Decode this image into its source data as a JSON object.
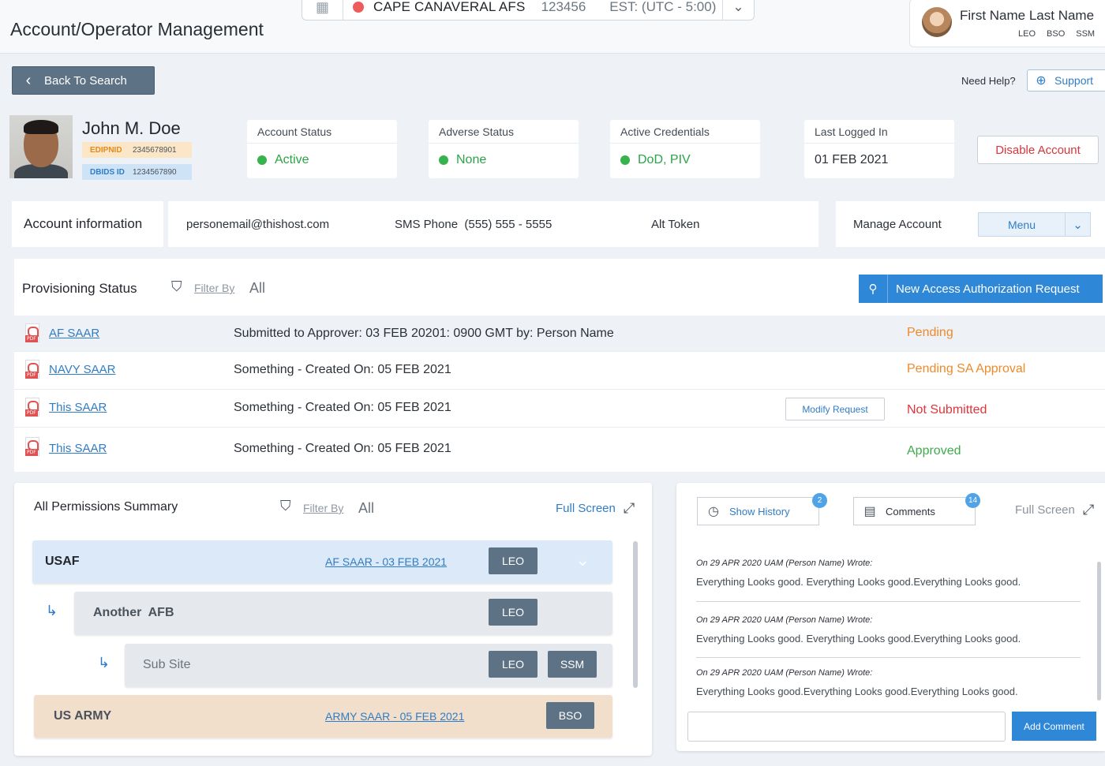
{
  "header": {
    "app_title": "Account/Operator Management",
    "site": {
      "name": "CAPE CANAVERAL AFS",
      "code": "123456",
      "timezone": "EST: (UTC - 5:00)",
      "status_color": "#ef5a5a"
    },
    "user": {
      "name": "First Name Last Name",
      "roles": [
        "LEO",
        "BSO",
        "SSM"
      ]
    }
  },
  "nav": {
    "back_label": "Back To Search",
    "need_help": "Need Help?",
    "support_label": "Support"
  },
  "profile": {
    "name": "John M. Doe",
    "edipnid_label": "EDIPNID",
    "edipnid_value": "2345678901",
    "dbids_label": "DBIDS ID",
    "dbids_value": "1234567890"
  },
  "stats": [
    {
      "label": "Account Status",
      "value": "Active"
    },
    {
      "label": "Adverse Status",
      "value": "None"
    },
    {
      "label": "Active Credentials",
      "value": "DoD, PIV"
    },
    {
      "label": "Last Logged In",
      "value": "01 FEB 2021"
    }
  ],
  "disable_label": "Disable Account",
  "account": {
    "label": "Account information",
    "email": "personemail@thishost.com",
    "sms": "SMS Phone  (555) 555 - 5555",
    "alt_token": "Alt Token",
    "manage_label": "Manage Account",
    "menu_label": "Menu"
  },
  "provisioning": {
    "title": "Provisioning Status",
    "filter_by": "Filter By",
    "filter_value": "All",
    "new_request": "New Access Authorization Request",
    "rows": [
      {
        "name": "AF SAAR",
        "desc": "Submitted to Approver: 03 FEB 20201: 0900 GMT by: Person Name",
        "status": "Pending"
      },
      {
        "name": "NAVY SAAR",
        "desc": "Something - Created On: 05 FEB 2021",
        "status": "Pending SA Approval"
      },
      {
        "name": "This SAAR",
        "desc": "Something - Created On: 05 FEB 2021",
        "status": "Not Submitted",
        "action": "Modify Request"
      },
      {
        "name": "This SAAR",
        "desc": "Something - Created On: 05 FEB 2021",
        "status": "Approved"
      }
    ]
  },
  "permissions": {
    "title": "All Permissions Summary",
    "filter_by": "Filter By",
    "filter_value": "All",
    "full_screen": "Full Screen",
    "rows": [
      {
        "label": "USAF",
        "link": "AF SAAR - 03 FEB 2021",
        "roles": [
          "LEO"
        ]
      },
      {
        "label": "Another  AFB",
        "roles": [
          "LEO"
        ]
      },
      {
        "label": "Sub Site",
        "roles": [
          "LEO",
          "SSM"
        ]
      },
      {
        "label": "US ARMY",
        "link": "ARMY SAAR - 05 FEB 2021",
        "roles": [
          "BSO"
        ]
      }
    ]
  },
  "comments": {
    "history_label": "Show History",
    "history_count": "2",
    "comments_label": "Comments",
    "comments_count": "14",
    "full_screen": "Full Screen",
    "items": [
      {
        "meta": "On 29 APR 2020 UAM (Person Name) Wrote:",
        "body": "Everything Looks good. Everything Looks good.Everything Looks good."
      },
      {
        "meta": "On 29 APR 2020 UAM (Person Name) Wrote:",
        "body": "Everything Looks good. Everything Looks good.Everything Looks good."
      },
      {
        "meta": "On 29 APR 2020 UAM (Person Name) Wrote:",
        "body": "Everything Looks good.Everything Looks good.Everything Looks good."
      }
    ],
    "add_label": "Add Comment"
  }
}
